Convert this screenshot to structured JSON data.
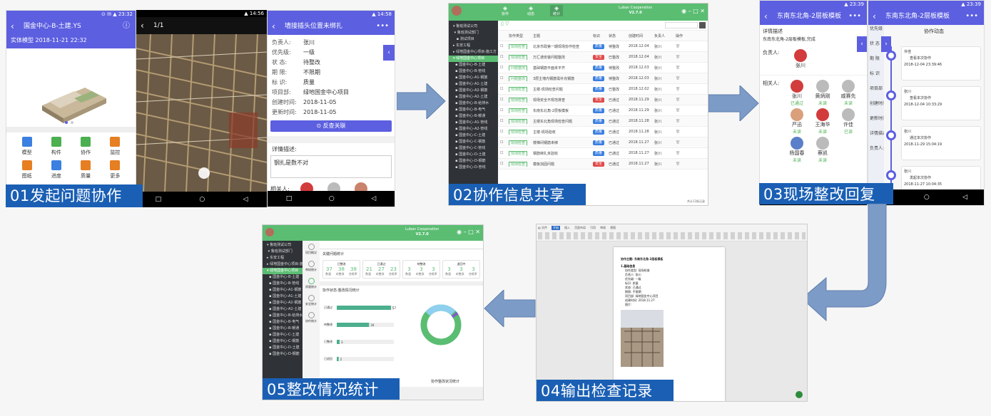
{
  "colors": {
    "blue_caption": "#1a5fb4",
    "arrow": "#7d9bc7",
    "purple": "#5c5fe0",
    "green": "#5bbd72",
    "dark_sidebar": "#2f3237"
  },
  "step1": {
    "caption": "01发起问题协作",
    "model_screen": {
      "title": "国金中心-B-土建.YS",
      "model_label": "实体模型 2018-11-21 22:32",
      "icons": [
        "模型",
        "构件",
        "协作",
        "监控",
        "图纸",
        "进度",
        "质量",
        "更多"
      ]
    },
    "photo_screen": {
      "counter": "1/1"
    },
    "detail_screen": {
      "title": "墙接插头位置未绑扎",
      "fields": [
        {
          "k": "负责人:",
          "v": "张川"
        },
        {
          "k": "优先级:",
          "v": "一级"
        },
        {
          "k": "状 态:",
          "v": "待整改"
        },
        {
          "k": "期 限:",
          "v": "不限期"
        },
        {
          "k": "标 识:",
          "v": "质量"
        },
        {
          "k": "项目部:",
          "v": "绿地国金中心项目"
        },
        {
          "k": "创建时间:",
          "v": "2018-11-05"
        },
        {
          "k": "更新时间:",
          "v": "2018-11-05"
        }
      ],
      "button": "反查关联",
      "desc_label": "详情描述:",
      "desc": "钢扎是数不对",
      "people_label": "相关人:",
      "people": [
        "张川",
        "徐凯",
        "严迅",
        "王海华"
      ]
    }
  },
  "step2": {
    "caption": "02协作信息共享",
    "title": "Luban Cooperation",
    "version": "V2.7.0",
    "tabs": [
      "协作",
      "动态",
      "统计"
    ],
    "columns": [
      "协作类型",
      "主题",
      "标识",
      "状态",
      "创建时间",
      "负责人",
      "操作"
    ],
    "rows": [
      {
        "type": "现场检查",
        "subject": "北京市政第一期现场协作检查",
        "tag": "质量",
        "status": "待整改",
        "date": "2018.12.04",
        "owner": "张川"
      },
      {
        "type": "现场检查",
        "subject": "万汇通安装问题整改",
        "tag": "安全",
        "status": "已整改",
        "date": "2018.12.04",
        "owner": "张川"
      },
      {
        "type": "问题整改",
        "subject": "基础钢筋平面未平齐",
        "tag": "质量",
        "status": "待整改",
        "date": "2018.12.03",
        "owner": "张川"
      },
      {
        "type": "问题整改",
        "subject": "3层主墙内钢筋需补充钢筋",
        "tag": "质量",
        "status": "待整改",
        "date": "2018.12.03",
        "owner": "张川"
      },
      {
        "type": "现场检查",
        "subject": "主楼-现场检查问题",
        "tag": "质量",
        "status": "已整改",
        "date": "2018.12.02",
        "owner": "张川"
      },
      {
        "type": "现场检查",
        "subject": "现场安全不规范排查",
        "tag": "安全",
        "status": "已通过",
        "date": "2018.11.29",
        "owner": "张川"
      },
      {
        "type": "现场检查",
        "subject": "东南东北角-2层板模板",
        "tag": "质量",
        "status": "已通过",
        "date": "2018.11.29",
        "owner": "张川"
      },
      {
        "type": "现场检查",
        "subject": "主楼东北角现场检查问题",
        "tag": "质量",
        "status": "已通过",
        "date": "2018.11.28",
        "owner": "张川"
      },
      {
        "type": "现场检查",
        "subject": "主楼-现场验收",
        "tag": "质量",
        "status": "已通过",
        "date": "2018.11.28",
        "owner": "张川"
      },
      {
        "type": "现场检查",
        "subject": "楼梯间钢筋未绑",
        "tag": "质量",
        "status": "已通过",
        "date": "2018.11.27",
        "owner": "张川"
      },
      {
        "type": "现场检查",
        "subject": "钢筋绑扎未验收",
        "tag": "质量",
        "status": "已通过",
        "date": "2018.11.27",
        "owner": "张川"
      },
      {
        "type": "现场检查",
        "subject": "模板加固问题",
        "tag": "安全",
        "status": "已通过",
        "date": "2018.11.27",
        "owner": "张川"
      }
    ],
    "footer": "共计13条记录"
  },
  "step3": {
    "caption": "03现场整改回复",
    "left": {
      "title": "东南东北角-2层板模板",
      "desc_label": "详情描述",
      "desc": "东南东北角-2层板模板,完成",
      "owner_label": "负责人:",
      "owner": "张川",
      "related_label": "相关人:",
      "people": [
        {
          "n": "张川",
          "s": "已通过"
        },
        {
          "n": "黄炳刚",
          "s": "未读"
        },
        {
          "n": "戚赛先",
          "s": "未读"
        },
        {
          "n": "严迅",
          "s": "未读"
        },
        {
          "n": "王海华",
          "s": "未读"
        },
        {
          "n": "许佳",
          "s": "已读"
        },
        {
          "n": "杨国春",
          "s": "未读"
        },
        {
          "n": "蔡凯",
          "s": "未读"
        }
      ]
    },
    "right": {
      "title": "东南东北角-2层板模板",
      "header": "协作动态",
      "labels": [
        "优先级",
        "状 态",
        "期 限",
        "标 识",
        "项目部",
        "创建时间",
        "更新时间",
        "详情描述",
        "负责人:"
      ],
      "items": [
        {
          "n": "许佳",
          "a": "查看本次协作",
          "t": "2018-12-04 23:39:46"
        },
        {
          "n": "张川",
          "a": "查看本次协作",
          "t": "2018-12-04 10:33:29"
        },
        {
          "n": "张川",
          "a": "通过本次协作",
          "t": "2018-11-29 15:04:19"
        },
        {
          "n": "张川",
          "a": "发起本次协作",
          "t": "2018-11-27 10:04:35"
        }
      ]
    }
  },
  "step4": {
    "caption": "04输出检查记录",
    "doc_title": "协作主题: 东南东北角-2层板模板",
    "section": "1.基础信息",
    "lines": [
      "协作类型: 现场检查",
      "负责人: 张川",
      "优先级: 一级",
      "标识: 质量",
      "状态: 已通过",
      "期限: 不限期",
      "项目部: 绿地国金中心项目",
      "创建时间: 2018.11.27"
    ],
    "image_label": "图片:"
  },
  "step5": {
    "caption": "05整改情况统计",
    "title": "Luban Cooperation",
    "version": "V2.7.0",
    "section": "关键问题统计",
    "chart_title": "协作状态-整改情况统计",
    "donut_title": "协作整改状况统计",
    "cards": [
      {
        "t": "已整改",
        "v": [
          "37",
          "38",
          "38"
        ]
      },
      {
        "t": "已通过",
        "v": [
          "21",
          "27",
          "23"
        ]
      },
      {
        "t": "待整改",
        "v": [
          "3",
          "3",
          "3"
        ]
      },
      {
        "t": "退回中",
        "v": [
          "3",
          "3",
          "3"
        ]
      }
    ],
    "card_sub": [
      "数量",
      "未整改",
      "合格率"
    ],
    "nav": [
      "项目概况",
      "审核统计",
      "质量统计",
      "安全统计",
      "协作统计"
    ]
  },
  "chart_data": {
    "type": "bar",
    "categories": [
      "已通过",
      "待整改",
      "已整改",
      "已退回"
    ],
    "values": [
      57,
      34,
      3,
      2
    ]
  }
}
